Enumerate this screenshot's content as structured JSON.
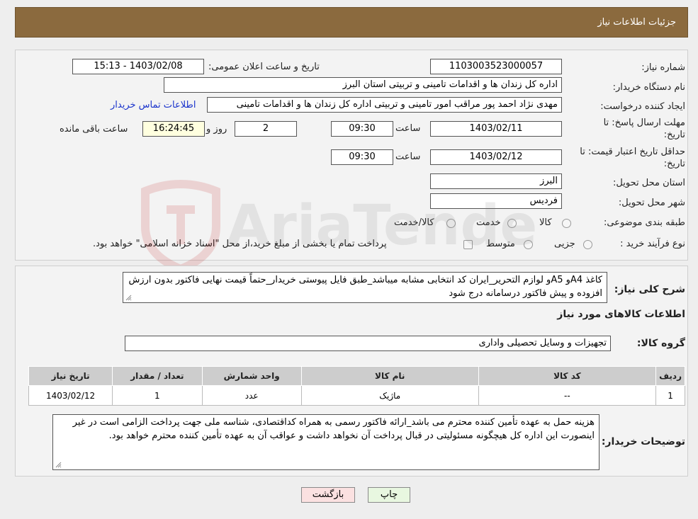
{
  "header": {
    "title": "جزئیات اطلاعات نیاز"
  },
  "fields": {
    "need_number_label": "شماره نیاز:",
    "need_number": "1103003523000057",
    "announce_label": "تاریخ و ساعت اعلان عمومی:",
    "announce_value": "1403/02/08 - 15:13",
    "buyer_org_label": "نام دستگاه خریدار:",
    "buyer_org": "اداره کل زندان ها و اقدامات تامینی و تربیتی استان البرز",
    "creator_label": "ایجاد کننده درخواست:",
    "creator": "مهدی نژاد احمد پور مراقب امور تامینی و تربیتی اداره کل زندان ها و اقدامات تامینی",
    "contact_link": "اطلاعات تماس خریدار",
    "deadline_label_1": "مهلت ارسال پاسخ: تا",
    "deadline_label_2": "تاریخ:",
    "deadline_date": "1403/02/11",
    "time_label": "ساعت",
    "deadline_time": "09:30",
    "days_value": "2",
    "days_label": "روز و",
    "remaining_time": "16:24:45",
    "remaining_label": "ساعت باقی مانده",
    "validity_label_1": "حداقل تاریخ اعتبار قیمت: تا",
    "validity_label_2": "تاریخ:",
    "validity_date": "1403/02/12",
    "validity_time_label": "ساعت",
    "validity_time": "09:30",
    "province_label": "استان محل تحویل:",
    "province": "البرز",
    "city_label": "شهر محل تحویل:",
    "city": "فردیس",
    "category_label": "طبقه بندی موضوعی:",
    "category_options": [
      "کالا",
      "خدمت",
      "کالا/خدمت"
    ],
    "process_label": "نوع فرآیند خرید :",
    "process_options": [
      "جزیی",
      "متوسط"
    ],
    "process_note": "پرداخت تمام یا بخشی از مبلغ خرید،از محل \"اسناد خزانه اسلامی\" خواهد بود."
  },
  "description": {
    "label": "شرح کلی نیاز:",
    "text": "کاغذ A4و A5و لوازم التحریر_ایران کد انتخابی مشابه میباشد_طبق فایل پیوستی خریدار_حتماً قیمت نهایی فاکتور بدون ارزش افزوده و پیش فاکتور درسامانه درج شود"
  },
  "goods": {
    "section_title": "اطلاعات کالاهای مورد نیاز",
    "group_label": "گروه کالا:",
    "group_value": "تجهیزات و وسایل تحصیلی واداری",
    "columns": [
      "ردیف",
      "کد کالا",
      "نام کالا",
      "واحد شمارش",
      "تعداد / مقدار",
      "تاریخ نیاز"
    ],
    "rows": [
      [
        "1",
        "--",
        "ماژیک",
        "عدد",
        "1",
        "1403/02/12"
      ]
    ]
  },
  "buyer_notes": {
    "label": "توضیحات خریدار:",
    "text": "هزینه حمل به عهده تأمین کننده محترم می باشد_ارائه فاکتور رسمی به همراه کداقتصادی، شناسه ملی جهت پرداخت الزامی است در غیر اینصورت این اداره کل هیچگونه مسئولیتی در قبال پرداخت آن نخواهد داشت و عواقب آن به عهده تأمین کننده محترم خواهد بود."
  },
  "buttons": {
    "print": "چاپ",
    "back": "بازگشت"
  },
  "watermark": {
    "text": "AriaTender.neT"
  },
  "colors": {
    "header_bg": "#8b6a3e",
    "link": "#1a33cc",
    "print_bg": "#e8f7e0",
    "back_bg": "#fbe1e1"
  }
}
